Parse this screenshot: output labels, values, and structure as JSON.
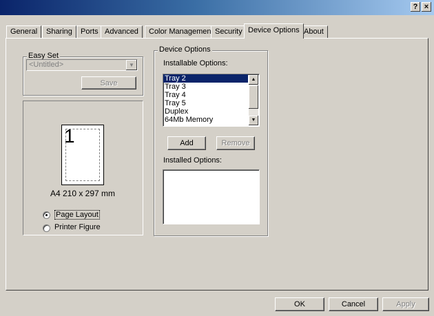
{
  "window": {
    "help_label": "?",
    "close_label": "×"
  },
  "tabs": [
    {
      "label": "General"
    },
    {
      "label": "Sharing"
    },
    {
      "label": "Ports"
    },
    {
      "label": "Advanced"
    },
    {
      "label": "Color Management"
    },
    {
      "label": "Security"
    },
    {
      "label": "Device Options",
      "active": true
    },
    {
      "label": "About"
    }
  ],
  "easy_set": {
    "group_label": "Easy Set",
    "selected_value": "<Untitled>",
    "save_label": "Save"
  },
  "preview": {
    "page_number": "1",
    "paper_size_text": "A4 210 x 297 mm",
    "radio_page_layout": "Page Layout",
    "radio_printer_figure": "Printer Figure"
  },
  "device_options": {
    "group_label": "Device Options",
    "installable_label": "Installable Options:",
    "installable_items": [
      "Tray 2",
      "Tray 3",
      "Tray 4",
      "Tray 5",
      "Duplex",
      "64Mb Memory"
    ],
    "selected_index": 0,
    "add_label": "Add",
    "remove_label": "Remove",
    "installed_label": "Installed Options:",
    "installed_items": []
  },
  "dialog_buttons": {
    "ok": "OK",
    "cancel": "Cancel",
    "apply": "Apply"
  }
}
